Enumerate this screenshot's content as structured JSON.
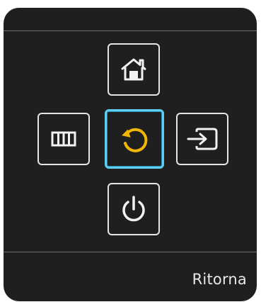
{
  "controls": {
    "home": {
      "icon": "home-icon"
    },
    "menu": {
      "icon": "menu-icon"
    },
    "return": {
      "icon": "return-icon",
      "selected": true
    },
    "source": {
      "icon": "source-input-icon"
    },
    "power": {
      "icon": "power-icon"
    }
  },
  "footer": {
    "label": "Ritorna"
  },
  "colors": {
    "panel_background": "#1f1f1f",
    "button_border": "#e6e6e6",
    "selected_border": "#5ecbf0",
    "return_icon": "#f2b705",
    "text": "#e8e8e8"
  }
}
